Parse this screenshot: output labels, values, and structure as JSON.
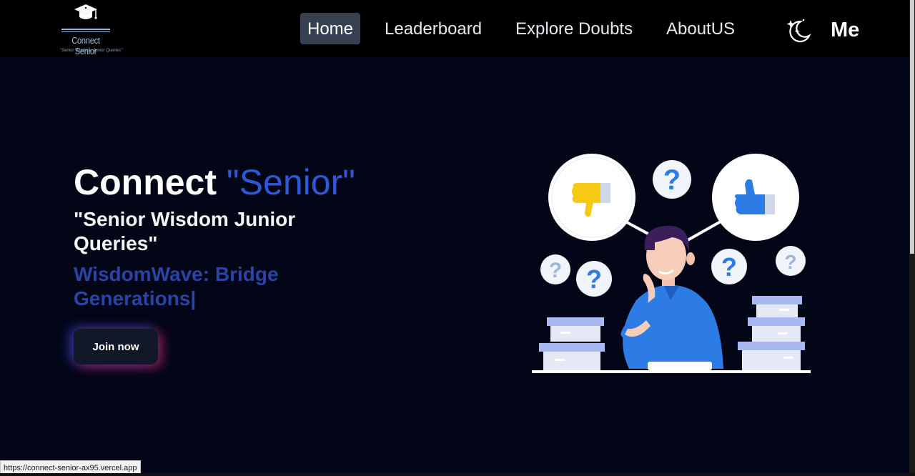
{
  "brand": {
    "name": "Connect Senior",
    "tagline": "\"Senior Wisdom, Junior Queries\""
  },
  "nav": {
    "items": [
      {
        "label": "Home",
        "active": true
      },
      {
        "label": "Leaderboard",
        "active": false
      },
      {
        "label": "Explore Doubts",
        "active": false
      },
      {
        "label": "AboutUS",
        "active": false
      }
    ],
    "theme_toggle_icon": "moon-stars-icon",
    "profile_label": "Me"
  },
  "hero": {
    "title_prefix": "Connect ",
    "title_accent": "\"Senior\"",
    "subtitle": "\"Senior Wisdom Junior Queries\"",
    "typed_text": "WisdomWave: Bridge Generations|",
    "cta_label": "Join now"
  },
  "status_bar": {
    "url": "https://connect-senior-ax95.vercel.app"
  },
  "colors": {
    "background": "#030617",
    "navbar": "#000000",
    "accent_blue": "#2f58d9",
    "typed_blue": "#2a44a6",
    "active_nav_bg": "#374151",
    "button_bg": "#111827"
  }
}
